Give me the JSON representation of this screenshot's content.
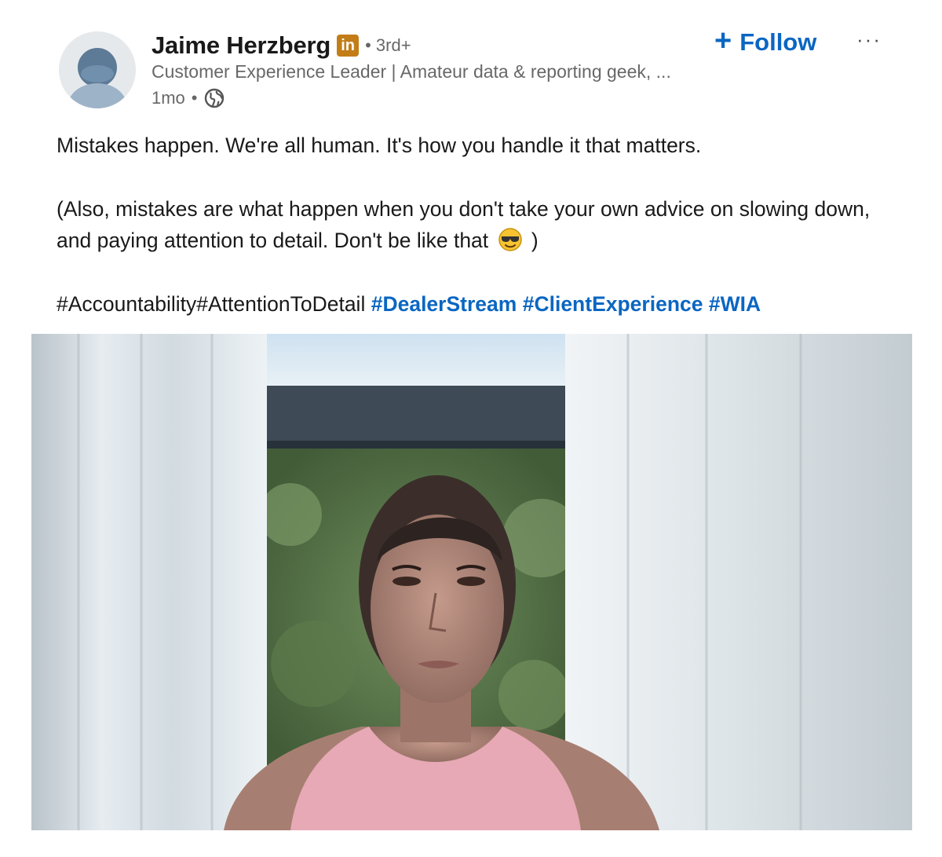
{
  "author": {
    "name": "Jaime Herzberg",
    "badge": "in",
    "degree": "• 3rd+",
    "headline": "Customer Experience Leader | Amateur data & reporting geek, ...",
    "time": "1mo",
    "dot": "•",
    "visibility_icon": "globe-icon"
  },
  "actions": {
    "follow_plus": "+",
    "follow_label": "Follow",
    "more_label": "···"
  },
  "post": {
    "line1": "Mistakes happen. We're all human. It's how you handle it that matters.",
    "line2_a": "(Also, mistakes are what happen when you don't take your own advice on slowing down, and paying attention to detail. Don't be like that",
    "line2_emoji": "smiling-face-with-sunglasses",
    "line2_b": ")",
    "hashtags_plain": [
      "#Accountability",
      "#AttentionToDetail"
    ],
    "hashtags_linked": [
      "#DealerStream",
      "#ClientExperience",
      "#WIA"
    ]
  },
  "media": {
    "type": "video",
    "subject": "woman-on-video-call"
  },
  "colors": {
    "link": "#0a66c2",
    "badge": "#c37d16",
    "muted": "rgba(0,0,0,0.6)"
  }
}
